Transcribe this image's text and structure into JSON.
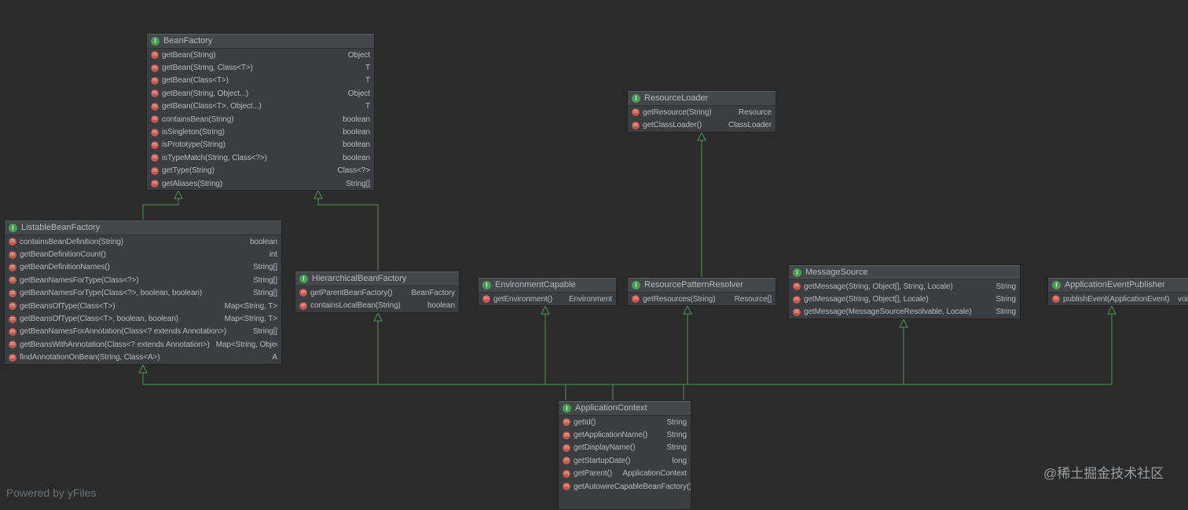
{
  "theme": {
    "bg": "#2b2b2b",
    "node-bg": "#3b3e41",
    "node-border": "#222425",
    "header-highlight": "#5c6062",
    "text": "#b6babd",
    "line": "#55915a",
    "interface-icon-bg": "#499C54",
    "method-icon-bg": "#C4554D"
  },
  "icons": {
    "interface_glyph": "I",
    "method_glyph": "m"
  },
  "footer": "Powered by yFiles",
  "watermark": "@稀土掘金技术社区",
  "classes": [
    {
      "name": "BeanFactory",
      "methods": [
        {
          "sig": "getBean(String)",
          "ret": "Object"
        },
        {
          "sig": "getBean(String, Class<T>)",
          "ret": "T"
        },
        {
          "sig": "getBean(Class<T>)",
          "ret": "T"
        },
        {
          "sig": "getBean(String, Object...)",
          "ret": "Object"
        },
        {
          "sig": "getBean(Class<T>, Object...)",
          "ret": "T"
        },
        {
          "sig": "containsBean(String)",
          "ret": "boolean"
        },
        {
          "sig": "isSingleton(String)",
          "ret": "boolean"
        },
        {
          "sig": "isPrototype(String)",
          "ret": "boolean"
        },
        {
          "sig": "isTypeMatch(String, Class<?>)",
          "ret": "boolean"
        },
        {
          "sig": "getType(String)",
          "ret": "Class<?>"
        },
        {
          "sig": "getAliases(String)",
          "ret": "String[]"
        }
      ]
    },
    {
      "name": "ResourceLoader",
      "methods": [
        {
          "sig": "getResource(String)",
          "ret": "Resource"
        },
        {
          "sig": "getClassLoader()",
          "ret": "ClassLoader"
        }
      ]
    },
    {
      "name": "ListableBeanFactory",
      "methods": [
        {
          "sig": "containsBeanDefinition(String)",
          "ret": "boolean"
        },
        {
          "sig": "getBeanDefinitionCount()",
          "ret": "int"
        },
        {
          "sig": "getBeanDefinitionNames()",
          "ret": "String[]"
        },
        {
          "sig": "getBeanNamesForType(Class<?>)",
          "ret": "String[]"
        },
        {
          "sig": "getBeanNamesForType(Class<?>, boolean, boolean)",
          "ret": "String[]"
        },
        {
          "sig": "getBeansOfType(Class<T>)",
          "ret": "Map<String, T>"
        },
        {
          "sig": "getBeansOfType(Class<T>, boolean, boolean)",
          "ret": "Map<String, T>"
        },
        {
          "sig": "getBeanNamesForAnnotation(Class<? extends Annotation>)",
          "ret": "String[]"
        },
        {
          "sig": "getBeansWithAnnotation(Class<? extends Annotation>)",
          "ret": "Map<String, Object>"
        },
        {
          "sig": "findAnnotationOnBean(String, Class<A>)",
          "ret": "A"
        }
      ]
    },
    {
      "name": "HierarchicalBeanFactory",
      "methods": [
        {
          "sig": "getParentBeanFactory()",
          "ret": "BeanFactory"
        },
        {
          "sig": "containsLocalBean(String)",
          "ret": "boolean"
        }
      ]
    },
    {
      "name": "EnvironmentCapable",
      "methods": [
        {
          "sig": "getEnvironment()",
          "ret": "Environment"
        }
      ]
    },
    {
      "name": "ResourcePatternResolver",
      "methods": [
        {
          "sig": "getResources(String)",
          "ret": "Resource[]"
        }
      ]
    },
    {
      "name": "MessageSource",
      "methods": [
        {
          "sig": "getMessage(String, Object[], String, Locale)",
          "ret": "String"
        },
        {
          "sig": "getMessage(String, Object[], Locale)",
          "ret": "String"
        },
        {
          "sig": "getMessage(MessageSourceResolvable, Locale)",
          "ret": "String"
        }
      ]
    },
    {
      "name": "ApplicationEventPublisher",
      "methods": [
        {
          "sig": "publishEvent(ApplicationEvent)",
          "ret": "void"
        }
      ]
    },
    {
      "name": "ApplicationContext",
      "methods": [
        {
          "sig": "getId()",
          "ret": "String"
        },
        {
          "sig": "getApplicationName()",
          "ret": "String"
        },
        {
          "sig": "getDisplayName()",
          "ret": "String"
        },
        {
          "sig": "getStartupDate()",
          "ret": "long"
        },
        {
          "sig": "getParent()",
          "ret": "ApplicationContext"
        },
        {
          "sig": "getAutowireCapableBeanFactory()",
          "ret": ""
        }
      ]
    }
  ]
}
